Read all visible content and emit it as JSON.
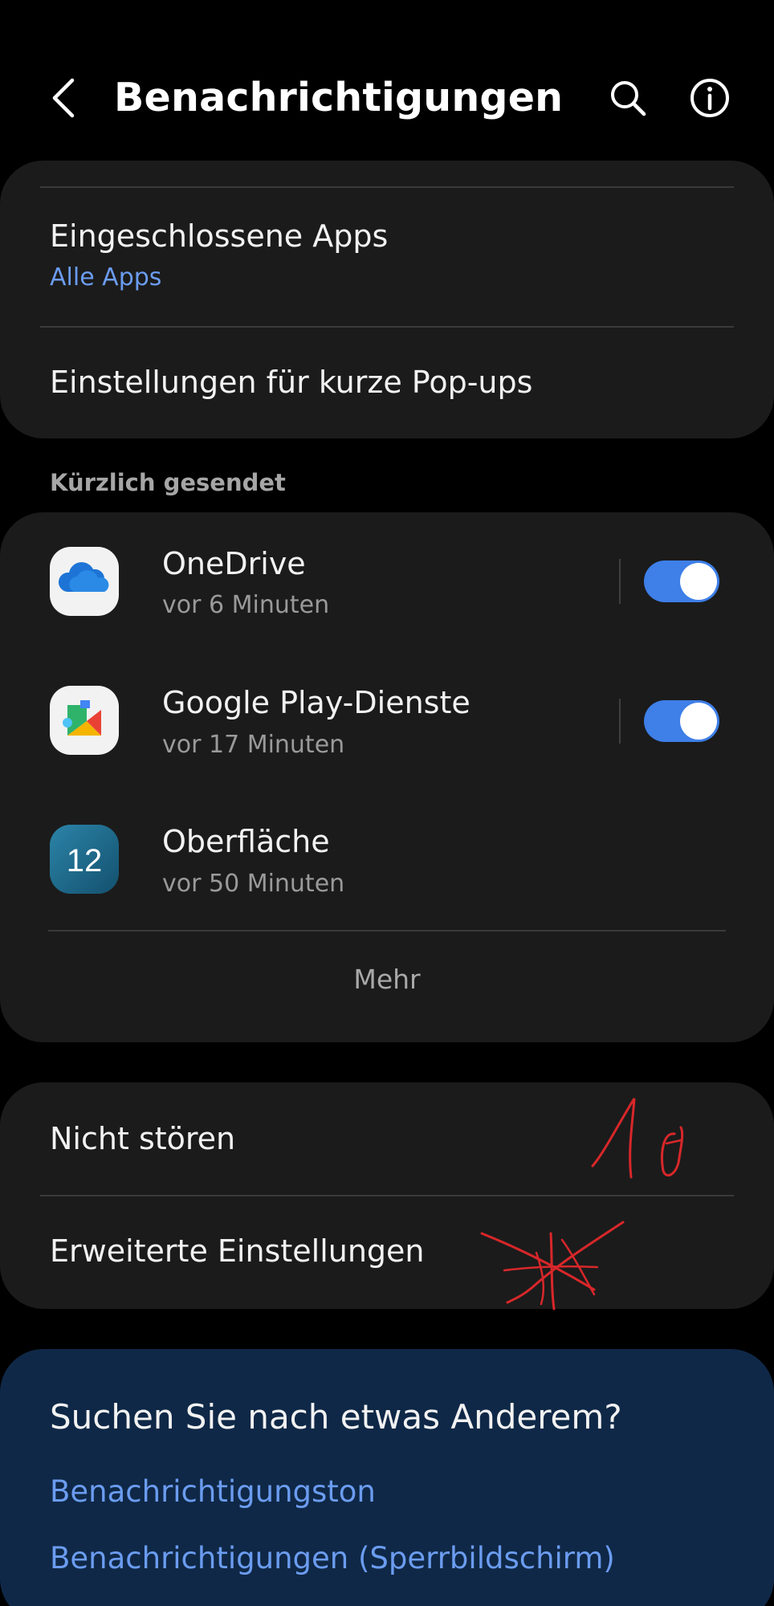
{
  "header": {
    "title": "Benachrichtigungen",
    "back_icon": "chevron-left-icon",
    "search_icon": "search-icon",
    "info_icon": "info-icon"
  },
  "included_apps": {
    "title": "Eingeschlossene Apps",
    "value": "Alle Apps"
  },
  "popup_settings": {
    "title": "Einstellungen für kurze Pop-ups"
  },
  "recent": {
    "label": "Kürzlich gesendet",
    "apps": [
      {
        "name": "OneDrive",
        "time": "vor 6 Minuten",
        "icon": "onedrive-icon",
        "toggle_on": true
      },
      {
        "name": "Google Play-Dienste",
        "time": "vor 17 Minuten",
        "icon": "google-play-services-icon",
        "toggle_on": true
      },
      {
        "name": "Oberfläche",
        "time": "vor 50 Minuten",
        "icon": "one-ui-12-icon",
        "badge_text": "12"
      }
    ],
    "more": "Mehr"
  },
  "settings": {
    "do_not_disturb": "Nicht stören",
    "advanced": "Erweiterte Einstellungen"
  },
  "suggestions": {
    "title": "Suchen Sie nach etwas Anderem?",
    "links": [
      "Benachrichtigungston",
      "Benachrichtigungen (Sperrbildschirm)"
    ]
  },
  "annotations": {
    "handwritten_number": "1",
    "color": "#d8272a"
  },
  "colors": {
    "accent": "#3e7fe8",
    "link": "#6b9cf0",
    "card": "#1b1b1b",
    "suggest_card": "#0f2847"
  }
}
